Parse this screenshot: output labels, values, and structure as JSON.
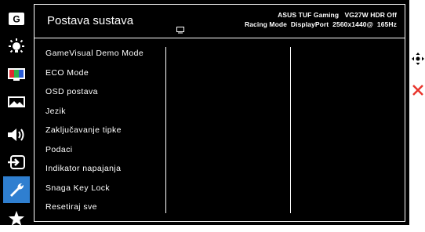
{
  "header": {
    "title": "Postava sustava",
    "status_line1": "ASUS TUF Gaming   VG27W HDR Off",
    "status_line2": "Racing Mode  DisplayPort  2560x1440@  165Hz"
  },
  "rail": {
    "items": [
      {
        "icon": "gamevisual-icon",
        "label": "G"
      },
      {
        "icon": "bluelight-filter-icon"
      },
      {
        "icon": "color-icon"
      },
      {
        "icon": "image-icon"
      },
      {
        "icon": "sound-icon"
      },
      {
        "icon": "input-select-icon"
      },
      {
        "icon": "system-setup-icon",
        "selected": true
      },
      {
        "icon": "myfavorite-star-icon"
      }
    ]
  },
  "menu": {
    "items": [
      "GameVisual Demo Mode",
      "ECO Mode",
      "OSD postava",
      "Jezik",
      "Zaključavanje tipke",
      "Podaci",
      "Indikator napajanja",
      "Snaga Key Lock",
      "Resetiraj sve"
    ]
  },
  "controls": {
    "navigate_icon": "five-way-joystick-icon",
    "exit_icon": "close-icon"
  },
  "colors": {
    "background": "#000000",
    "selected": "#2f7fd0",
    "text": "#ffffff",
    "exit": "#e8342c"
  }
}
